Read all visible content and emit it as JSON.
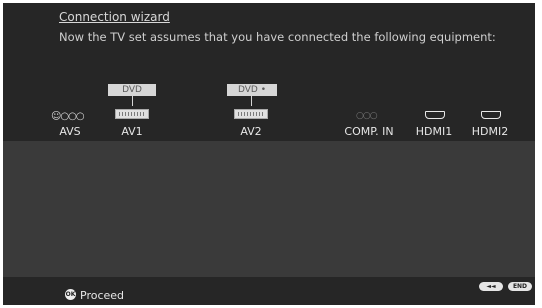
{
  "wizard": {
    "title": "Connection wizard",
    "message": "Now the TV set assumes that you have connected the following equipment:"
  },
  "ports": [
    {
      "label": "AVS",
      "icon": "avs-icon",
      "device": ""
    },
    {
      "label": "AV1",
      "icon": "scart-icon",
      "device": "DVD"
    },
    {
      "label": "AV2",
      "icon": "scart-icon",
      "device": "DVD •"
    },
    {
      "label": "COMP. IN",
      "icon": "component-icon",
      "device": ""
    },
    {
      "label": "HDMI1",
      "icon": "hdmi-icon",
      "device": ""
    },
    {
      "label": "HDMI2",
      "icon": "hdmi-icon",
      "device": ""
    }
  ],
  "footer": {
    "ok_key": "OK",
    "proceed_label": "Proceed",
    "back_key": "◄◄",
    "end_key": "END"
  },
  "icons": {
    "avs_glyphs": "☺○○○",
    "comp_glyphs": "○○○"
  },
  "colors": {
    "background": "#2a2a2a",
    "mid_band": "#3a3a3a",
    "text": "#e6e6e6",
    "device_tag": "#d6d6d6"
  }
}
